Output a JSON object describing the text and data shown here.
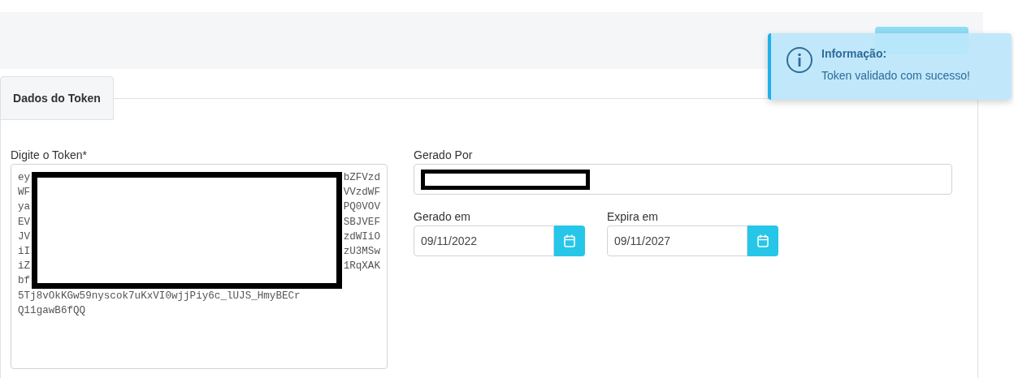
{
  "tab": {
    "label": "Dados do Token",
    "selected": true
  },
  "token": {
    "label": "Digite o Token*",
    "redacted_rows": [
      {
        "left": "ey",
        "right": "bZFVzd"
      },
      {
        "left": "WF",
        "right": "VVzdWF"
      },
      {
        "left": "ya",
        "right": "PQ0VOV"
      },
      {
        "left": "EV",
        "right": "SBJVEF"
      },
      {
        "left": "JV",
        "right": "zdWIiO"
      },
      {
        "left": "iI",
        "right": "zU3MSw"
      },
      {
        "left": "iZ",
        "right": "1RqXAK"
      },
      {
        "left": "bf",
        "right": ""
      }
    ],
    "lines": [
      "5Tj8vOkKGw59nyscok7uKxVI0wjjPiy6c_lUJS_HmyBECr",
      "Q11gawB6fQQ"
    ]
  },
  "generated_by": {
    "label": "Gerado Por"
  },
  "generated_on": {
    "label": "Gerado em",
    "value": "09/11/2022"
  },
  "expires_on": {
    "label": "Expira em",
    "value": "09/11/2027"
  },
  "toast": {
    "title": "Informação:",
    "message": "Token validado com sucesso!"
  }
}
